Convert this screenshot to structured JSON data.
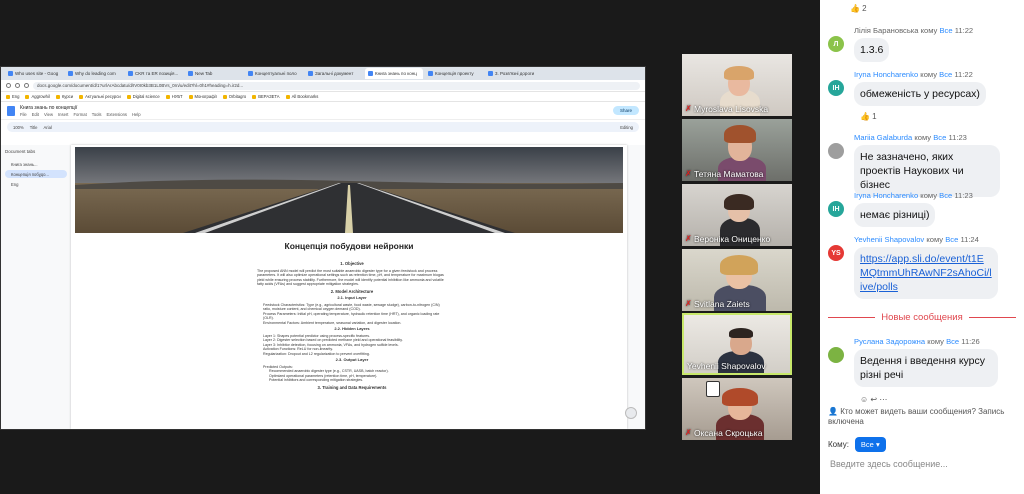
{
  "browser": {
    "tabs": [
      "Who uses site - Goog",
      "Why do leading com",
      "CKR та ER позиція...",
      "New Tab",
      "Концептуальні поло",
      "Загальні документ",
      "Книга знань по конц",
      "Концепція проекту",
      "3. Розв'язні дороги"
    ],
    "url": "docs.google.com/document/d/1?urlArAbcdatu/d/IV0I0kb3B1L0BVs_0rn/u/edit?hl=0h1#heading=h.ir2d...",
    "bookmarks": [
      "Eng",
      "Aggrowhil",
      "Курси",
      "Актуальні ресурси",
      "Digital science",
      "НУБТ",
      "Монографії",
      "Orbitagro",
      "ВЕРАЗЕТА",
      "All Bookmarks"
    ]
  },
  "docs": {
    "title": "Книга знань по концепції",
    "menu": [
      "File",
      "Edit",
      "View",
      "Insert",
      "Format",
      "Tools",
      "Extensions",
      "Help"
    ],
    "share_label": "Share",
    "toolbar": [
      "100%",
      "Title",
      "Arial",
      "Editing"
    ],
    "outline_title": "Document tabs",
    "outline_items": [
      "Книга знань...",
      "Концепція побудо...",
      "Eng"
    ],
    "doc_title": "Концепція побудови нейронки",
    "sections": {
      "s1": "1. Objective",
      "s1_text": "The proposed ANN model will predict the most suitable anaerobic digester type for a given feedstock and process parameters. It will also optimize operational settings such as retention time, pH, and temperature for maximum biogas yield while ensuring process stability. Furthermore, the model will identify potential inhibition like ammonia and volatile fatty acids (VFAs) and suggest appropriate mitigation strategies.",
      "s2": "2. Model Architecture",
      "s21": "2.1. Input Layer",
      "s21_b1": "Feedstock Characteristics: Type (e.g., agricultural waste, food waste, sewage sludge), carbon-to-nitrogen (C/N) ratio, moisture content, and chemical oxygen demand (COD).",
      "s21_b2": "Process Parameters: Initial pH, operating temperature, hydraulic retention time (HRT), and organic loading rate (OLR).",
      "s21_b3": "Environmental Factors: Ambient temperature, seasonal variation, and digester location.",
      "s22": "2.2. Hidden Layers",
      "s22_b1": "Layer 1: Shapes potential predictor using process-specific features.",
      "s22_b2": "Layer 2: Digester selection based on predicted methane yield and operational feasibility.",
      "s22_b3": "Layer 3: Inhibitor detection, focusing on ammonia, VFAs, and hydrogen sulfide levels.",
      "s22_b4": "Activation Functions: ReLU for non-linearity.",
      "s22_b5": "Regularization: Dropout and L2 regularization to prevent overfitting.",
      "s23": "2.3. Output Layer",
      "s23_b1": "Predicted Outputs:",
      "s23_b1a": "Recommended anaerobic digester type (e.g., CSTR, UASB, batch reactor).",
      "s23_b1b": "Optimized operational parameters (retention time, pH, temperature).",
      "s23_b1c": "Potential inhibitors and corresponding mitigation strategies.",
      "s3": "3. Training and Data Requirements"
    }
  },
  "participants": [
    {
      "name": "Myroslava Lisovska",
      "muted": true
    },
    {
      "name": "Тетяна Маматова",
      "muted": true
    },
    {
      "name": "Вероніка Ониценко",
      "muted": true
    },
    {
      "name": "Svitlana Zaiets",
      "muted": true
    },
    {
      "name": "Yevhenii Shapovalov",
      "muted": false,
      "active": true
    },
    {
      "name": "Оксана Скроцька",
      "muted": true
    }
  ],
  "chat": {
    "top_reaction": "👍 2",
    "messages": [
      {
        "avatar": "Л",
        "avatar_color": "#8bc34a",
        "sender": "Лілія Барановська",
        "to_word": "кому",
        "to": "Все",
        "time": "11:22",
        "text": "1.3.6"
      },
      {
        "avatar": "IH",
        "avatar_color": "#26a69a",
        "sender": "Iryna Honcharenko",
        "to_word": "кому",
        "to": "Все",
        "time": "11:22",
        "text": "обмеженість у ресурсах)",
        "reaction": "👍 1"
      },
      {
        "avatar": "",
        "avatar_color": "#9e9e9e",
        "sender": "Mariia Galaburda",
        "to_word": "кому",
        "to": "Все",
        "time": "11:23",
        "text": "Не зазначено, яких проектів Наукових чи бізнес"
      },
      {
        "avatar": "IH",
        "avatar_color": "#26a69a",
        "sender": "Iryna Honcharenko",
        "to_word": "кому",
        "to": "Все",
        "time": "11:23",
        "text": "немає різниці)"
      },
      {
        "avatar": "YS",
        "avatar_color": "#e53935",
        "sender": "Yevhenii Shapovalov",
        "to_word": "кому",
        "to": "Все",
        "time": "11:24",
        "text": "https://app.sli.do/event/t1EMQtmmUhRAwNF2sAhoCi/live/polls"
      },
      {
        "avatar": "",
        "avatar_color": "#7cb342",
        "sender": "Руслана Задорожна",
        "to_word": "кому",
        "to": "Все",
        "time": "11:26",
        "text": "Ведення і введення курсу різні речі"
      }
    ],
    "new_messages_label": "Новые сообщения",
    "who_can_see": "Кто может видеть ваши сообщения? Запись включена",
    "to_label": "Кому:",
    "to_value": "Все",
    "placeholder": "Введите здесь сообщение..."
  },
  "colors": {
    "accent": "#2d8cff",
    "new_separator": "#e0484f",
    "active_tile": "#c8e86b"
  }
}
